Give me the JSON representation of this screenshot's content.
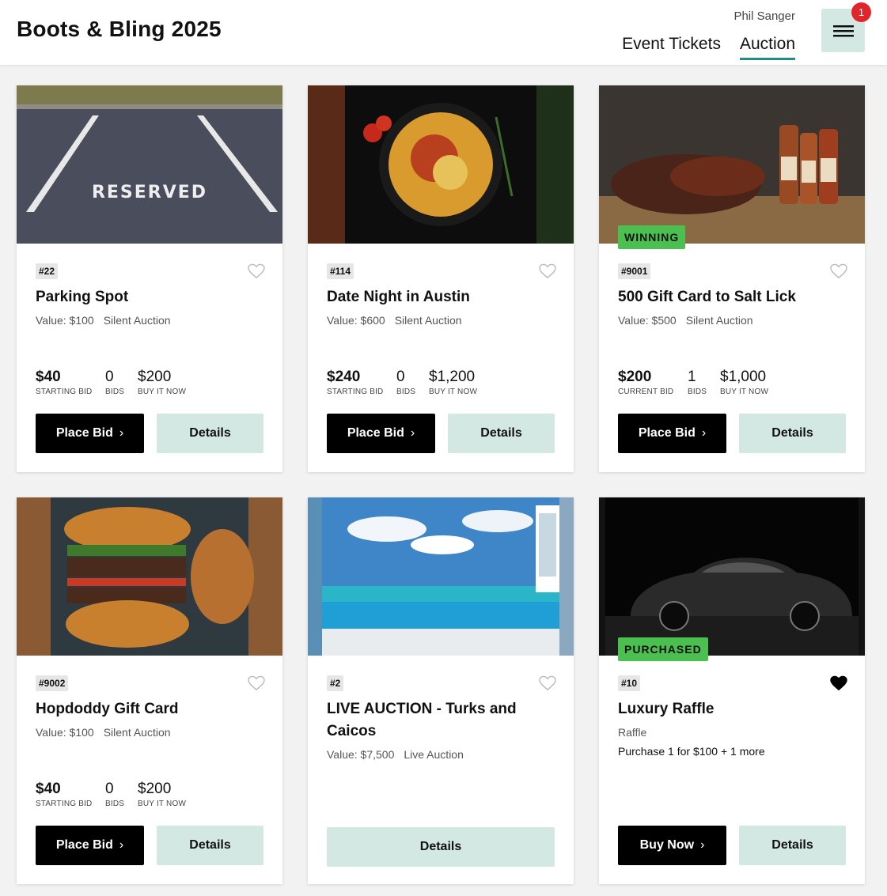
{
  "header": {
    "title": "Boots & Bling 2025",
    "user_name": "Phil Sanger",
    "nav": [
      {
        "label": "Event Tickets",
        "active": false
      },
      {
        "label": "Auction",
        "active": true
      }
    ],
    "menu_icon": "hamburger-menu-icon",
    "notification_count": "1"
  },
  "colors": {
    "accent_underline": "#1f8f7f",
    "details_button": "#d3e8e2",
    "status_tag": "#4bbf4f",
    "badge": "#e0262b"
  },
  "items": [
    {
      "lot": "#22",
      "name": "Parking Spot",
      "value": "Value: $100",
      "type": "Silent Auction",
      "favorited": false,
      "status": "",
      "stats": [
        {
          "value": "$40",
          "label": "STARTING BID"
        },
        {
          "value": "0",
          "label": "BIDS"
        },
        {
          "value": "$200",
          "label": "BUY IT NOW"
        }
      ],
      "primary_button": "Place Bid",
      "details_button": "Details"
    },
    {
      "lot": "#114",
      "name": "Date Night in Austin",
      "value": "Value: $600",
      "type": "Silent Auction",
      "favorited": false,
      "status": "",
      "stats": [
        {
          "value": "$240",
          "label": "STARTING BID"
        },
        {
          "value": "0",
          "label": "BIDS"
        },
        {
          "value": "$1,200",
          "label": "BUY IT NOW"
        }
      ],
      "primary_button": "Place Bid",
      "details_button": "Details"
    },
    {
      "lot": "#9001",
      "name": "500 Gift Card to Salt Lick",
      "value": "Value: $500",
      "type": "Silent Auction",
      "favorited": false,
      "status": "WINNING",
      "stats": [
        {
          "value": "$200",
          "label": "CURRENT BID"
        },
        {
          "value": "1",
          "label": "BIDS"
        },
        {
          "value": "$1,000",
          "label": "BUY IT NOW"
        }
      ],
      "primary_button": "Place Bid",
      "details_button": "Details"
    },
    {
      "lot": "#9002",
      "name": "Hopdoddy Gift Card",
      "value": "Value: $100",
      "type": "Silent Auction",
      "favorited": false,
      "status": "",
      "stats": [
        {
          "value": "$40",
          "label": "STARTING BID"
        },
        {
          "value": "0",
          "label": "BIDS"
        },
        {
          "value": "$200",
          "label": "BUY IT NOW"
        }
      ],
      "primary_button": "Place Bid",
      "details_button": "Details"
    },
    {
      "lot": "#2",
      "name": "LIVE AUCTION - Turks and Caicos",
      "value": "Value: $7,500",
      "type": "Live Auction",
      "favorited": false,
      "status": "",
      "details_button": "Details"
    },
    {
      "lot": "#10",
      "name": "Luxury Raffle",
      "type": "Raffle",
      "raffle_description": "Purchase 1 for $100 + 1 more",
      "favorited": true,
      "status": "PURCHASED",
      "primary_button": "Buy Now",
      "details_button": "Details"
    }
  ]
}
